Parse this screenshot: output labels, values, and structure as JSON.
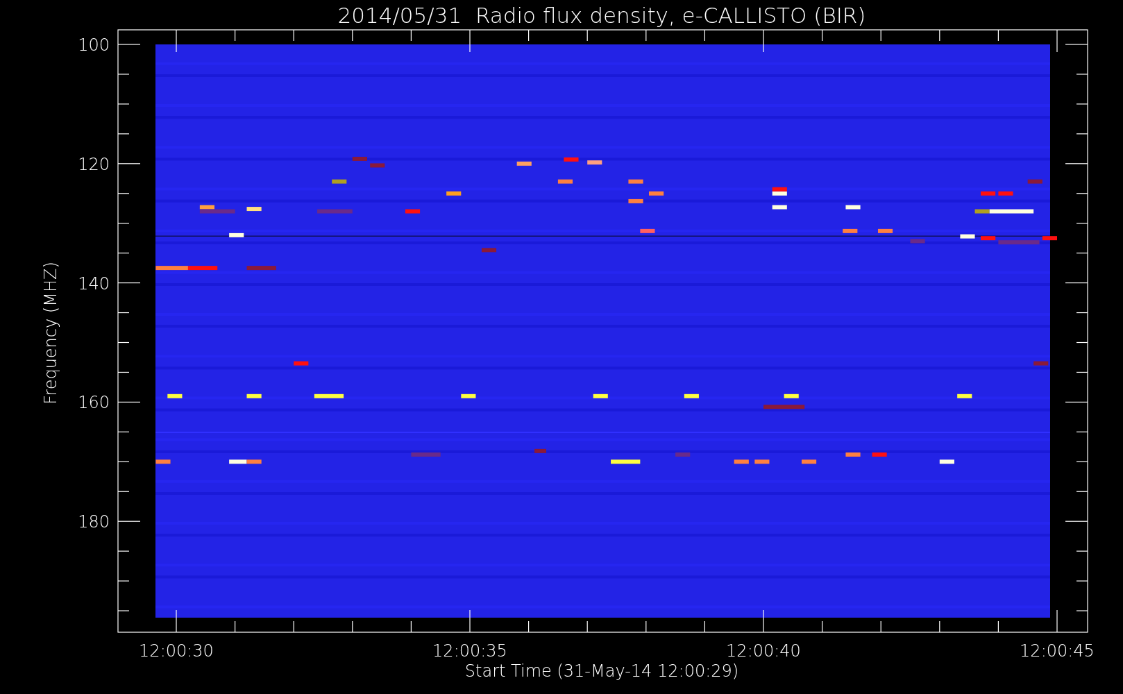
{
  "plot": {
    "title": "2014/05/31  Radio flux density, e-CALLISTO (BIR)",
    "ylabel": "Frequency (MHZ)",
    "xlabel": "Start Time (31-May-14 12:00:29)",
    "yticks": [
      "100",
      "120",
      "140",
      "160",
      "180"
    ],
    "xticks": [
      "12:00:30",
      "12:00:35",
      "12:00:40",
      "12:00:45"
    ]
  }
}
